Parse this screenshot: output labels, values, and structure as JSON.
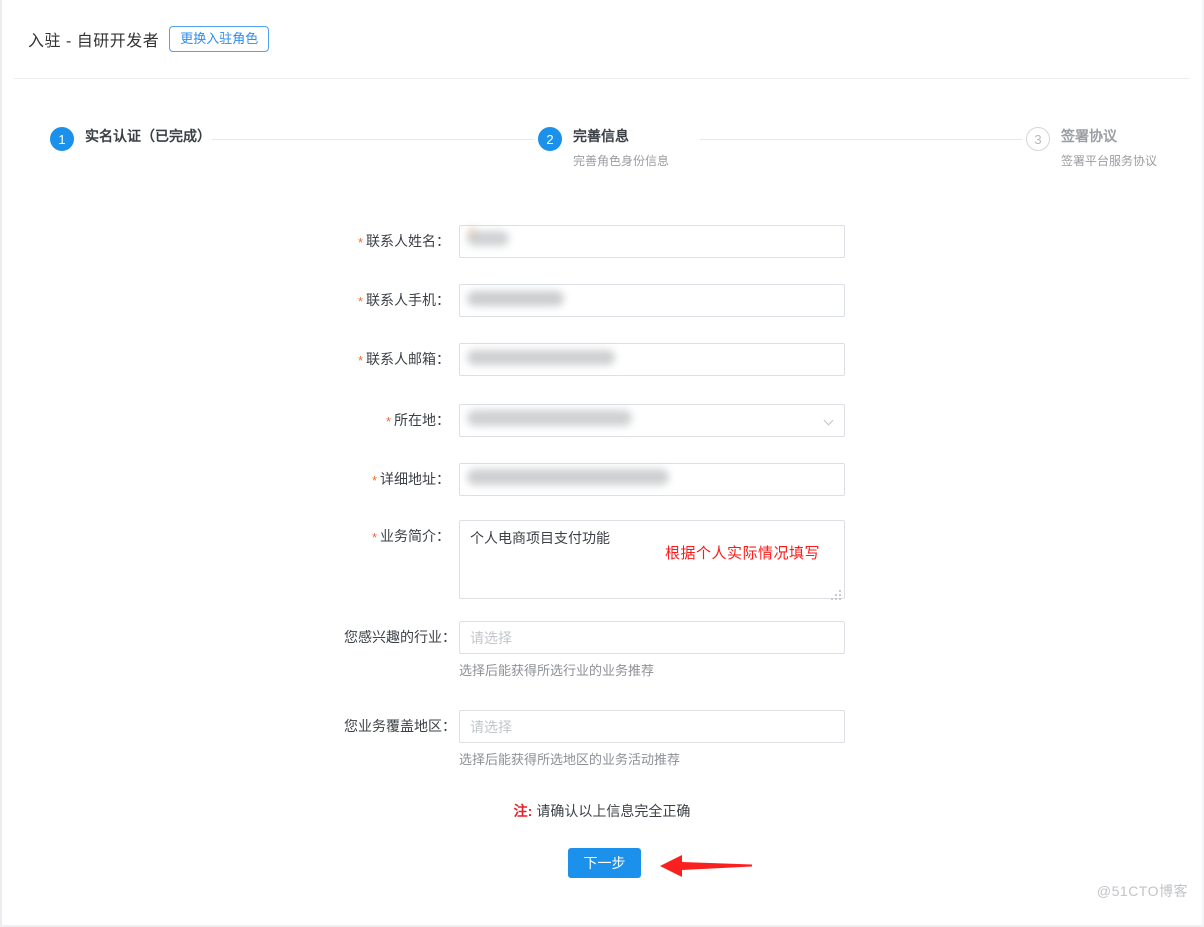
{
  "header": {
    "title": "入驻 -  自研开发者",
    "role_change_label": "更换入驻角色"
  },
  "steps": [
    {
      "number": "1",
      "title": "实名认证（已完成）",
      "subtitle": "",
      "state": "active"
    },
    {
      "number": "2",
      "title": "完善信息",
      "subtitle": "完善角色身份信息",
      "state": "active"
    },
    {
      "number": "3",
      "title": "签署协议",
      "subtitle": "签署平台服务协议",
      "state": "inactive"
    }
  ],
  "form": {
    "contact_name": {
      "label": "联系人姓名：",
      "required": true,
      "value": "",
      "placeholder": ""
    },
    "contact_phone": {
      "label": "联系人手机：",
      "required": true,
      "value": "",
      "placeholder": ""
    },
    "contact_email": {
      "label": "联系人邮箱：",
      "required": true,
      "value": "",
      "placeholder": ""
    },
    "location": {
      "label": "所在地：",
      "required": true,
      "value": "",
      "placeholder": ""
    },
    "address": {
      "label": "详细地址：",
      "required": true,
      "value": "",
      "placeholder": ""
    },
    "business_intro": {
      "label": "业务简介：",
      "required": true,
      "value": "个人电商项目支付功能",
      "annotation": "根据个人实际情况填写"
    },
    "industry": {
      "label": "您感兴趣的行业：",
      "required": false,
      "value": "",
      "placeholder": "请选择",
      "hint": "选择后能获得所选行业的业务推荐"
    },
    "coverage_region": {
      "label": "您业务覆盖地区：",
      "required": false,
      "value": "",
      "placeholder": "请选择",
      "hint": "选择后能获得所选地区的业务活动推荐"
    }
  },
  "notice": {
    "mark": "注:",
    "text": "请确认以上信息完全正确"
  },
  "submit": {
    "label": "下一步"
  },
  "watermark": "@51CTO博客",
  "colors": {
    "accent": "#1b91eb",
    "required_star": "#f56c2d",
    "annotation_red": "#ff1a1a",
    "notice_red": "#e8202a"
  }
}
